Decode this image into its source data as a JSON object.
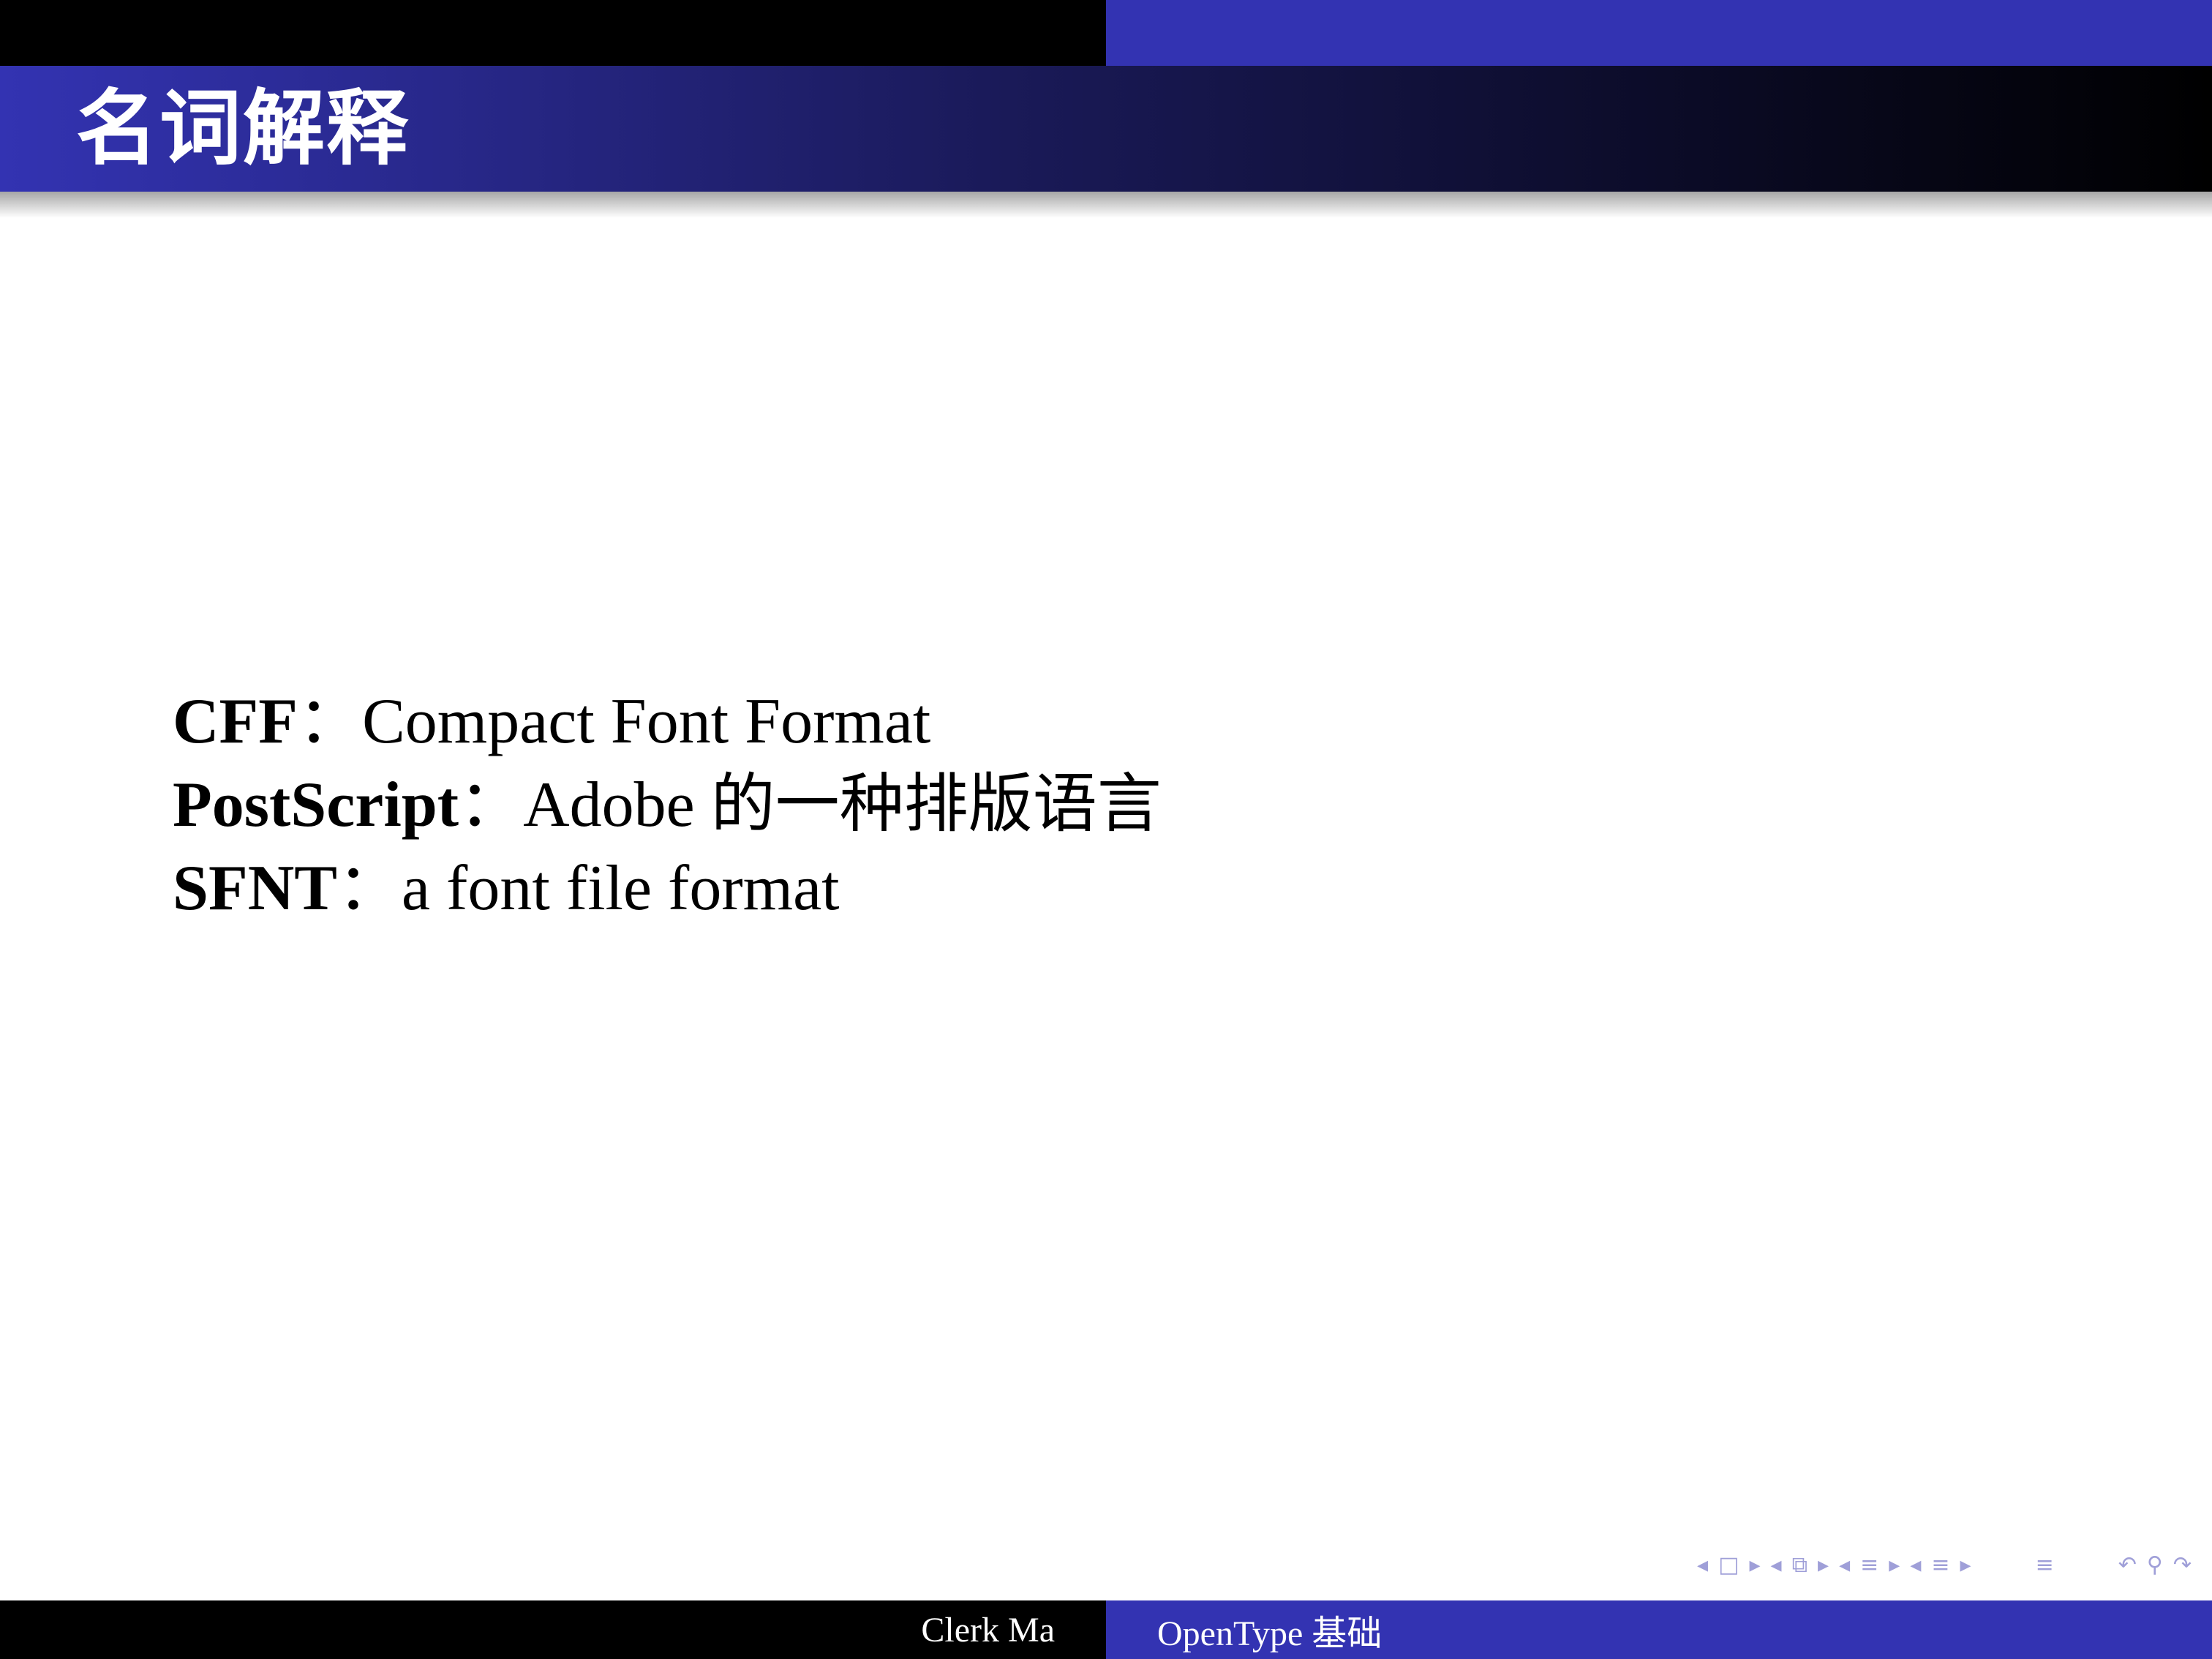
{
  "frame": {
    "title": "名词解释"
  },
  "definitions": [
    {
      "term": "CFF",
      "separator": "：",
      "text": "Compact Font Format"
    },
    {
      "term": "PostScript",
      "separator": "：",
      "text": "Adobe 的一种排版语言"
    },
    {
      "term": "SFNT",
      "separator": "：",
      "text": "a font file format"
    }
  ],
  "navigation": {
    "icons": [
      "arrow-left-icon",
      "frame-icon",
      "arrow-right-icon",
      "arrow-left-icon",
      "subsection-icon",
      "arrow-right-icon",
      "arrow-left-icon",
      "section-icon",
      "arrow-right-icon",
      "arrow-left-icon",
      "presentation-icon",
      "arrow-right-icon",
      "appendix-icon",
      "back-icon",
      "search-icon",
      "forward-icon"
    ]
  },
  "footer": {
    "author": "Clerk Ma",
    "title": "OpenType 基础"
  },
  "colors": {
    "beamer_blue": "#3333b2",
    "nav_symbol": "#9f9fd8",
    "black": "#000000"
  }
}
